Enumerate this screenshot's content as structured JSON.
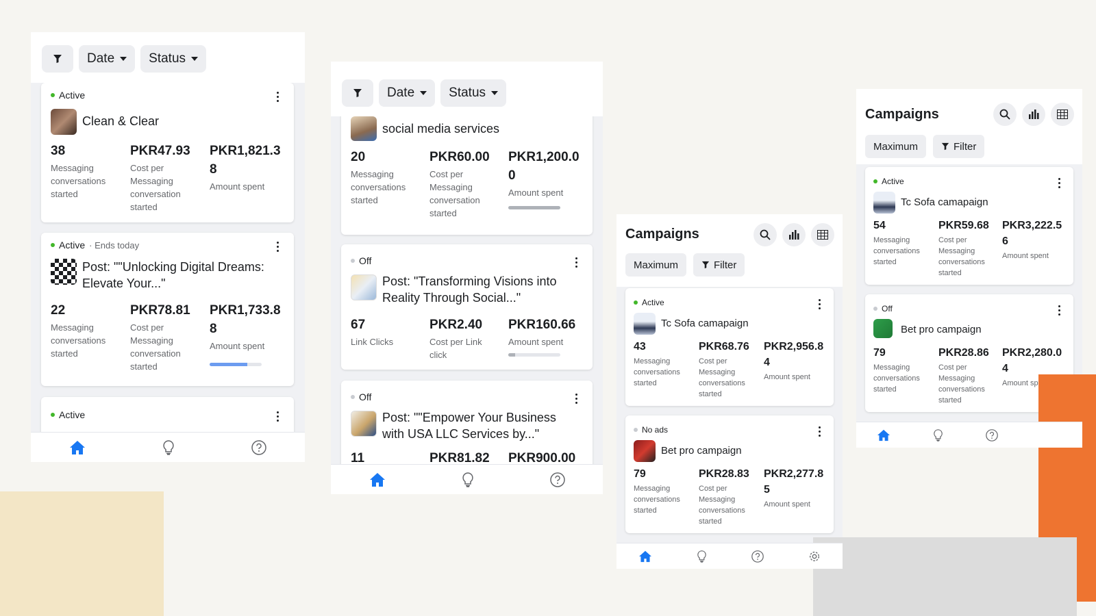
{
  "filters": {
    "date_label": "Date",
    "status_label": "Status"
  },
  "panel1": {
    "cards": [
      {
        "status": "Active",
        "name": "Clean & Clear",
        "m1_value": "38",
        "m1_label": "Messaging conversations started",
        "m2_value": "PKR47.93",
        "m2_label": "Cost per Messaging conversation started",
        "m3_value": "PKR1,821.38",
        "m3_label": "Amount spent"
      },
      {
        "status": "Active",
        "ends": "· Ends today",
        "name": "Post: \"\"Unlocking Digital Dreams: Elevate Your...\"",
        "m1_value": "22",
        "m1_label": "Messaging conversations started",
        "m2_value": "PKR78.81",
        "m2_label": "Cost per Messaging conversation started",
        "m3_value": "PKR1,733.88",
        "m3_label": "Amount spent",
        "progress": 0.72
      },
      {
        "status": "Active"
      }
    ]
  },
  "panel2": {
    "cards": [
      {
        "name": "social media services",
        "m1_value": "20",
        "m1_label": "Messaging conversations started",
        "m2_value": "PKR60.00",
        "m2_label": "Cost per Messaging conversation started",
        "m3_value": "PKR1,200.00",
        "m3_label": "Amount spent",
        "progress": 1.0
      },
      {
        "status": "Off",
        "name": "Post: \"Transforming Visions into Reality Through Social...\"",
        "m1_value": "67",
        "m1_label": "Link Clicks",
        "m2_value": "PKR2.40",
        "m2_label": "Cost per Link click",
        "m3_value": "PKR160.66",
        "m3_label": "Amount spent",
        "progress": 0.13
      },
      {
        "status": "Off",
        "name": "Post: \"\"Empower Your Business with USA LLC Services by...\"",
        "m1_value": "11",
        "m2_value": "PKR81.82",
        "m3_value": "PKR900.00"
      }
    ]
  },
  "panel3": {
    "title": "Campaigns",
    "maximum_label": "Maximum",
    "filter_label": "Filter",
    "cards": [
      {
        "status": "Active",
        "name": "Tc Sofa camapaign",
        "m1_value": "43",
        "m1_label": "Messaging conversations started",
        "m2_value": "PKR68.76",
        "m2_label": "Cost per Messaging conversations started",
        "m3_value": "PKR2,956.84",
        "m3_label": "Amount spent"
      },
      {
        "status": "No ads",
        "name": "Bet pro campaign",
        "m1_value": "79",
        "m1_label": "Messaging conversations started",
        "m2_value": "PKR28.83",
        "m2_label": "Cost per Messaging conversations started",
        "m3_value": "PKR2,277.85",
        "m3_label": "Amount spent"
      }
    ]
  },
  "panel4": {
    "title": "Campaigns",
    "maximum_label": "Maximum",
    "filter_label": "Filter",
    "cards": [
      {
        "status": "Active",
        "name": "Tc Sofa camapaign",
        "m1_value": "54",
        "m1_label": "Messaging conversations started",
        "m2_value": "PKR59.68",
        "m2_label": "Cost per Messaging conversations started",
        "m3_value": "PKR3,222.56",
        "m3_label": "Amount spent"
      },
      {
        "status": "Off",
        "name": "Bet pro campaign",
        "m1_value": "79",
        "m1_label": "Messaging conversations started",
        "m2_value": "PKR28.86",
        "m2_label": "Cost per Messaging conversations started",
        "m3_value": "PKR2,280.04",
        "m3_label": "Amount sp"
      }
    ]
  },
  "icons": {
    "filter": "filter-icon",
    "home": "home-icon",
    "ideas": "lightbulb-icon",
    "help": "help-icon",
    "search": "search-icon",
    "chart": "bar-chart-icon",
    "table": "table-icon"
  },
  "colors": {
    "accent": "#1877f2",
    "active": "#42b72a",
    "off": "#c8cbd0",
    "orange": "#ee7430",
    "beige": "#f3e6c6"
  }
}
